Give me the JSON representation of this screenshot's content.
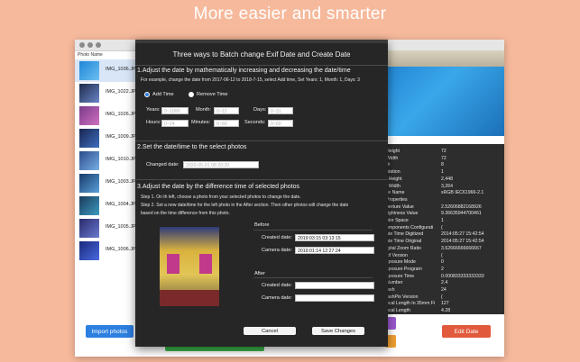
{
  "banner": {
    "title": "More easier and smarter"
  },
  "main_window": {
    "list_header": "Photo Name",
    "photos": [
      {
        "name": "IMG_1036.JPG",
        "selected": true
      },
      {
        "name": "IMG_1022.JPG",
        "selected": false
      },
      {
        "name": "IMG_1026.JPG",
        "selected": false
      },
      {
        "name": "IMG_1009.JPG",
        "selected": false
      },
      {
        "name": "IMG_1010.JPG",
        "selected": false
      },
      {
        "name": "IMG_1003.JPG",
        "selected": false
      },
      {
        "name": "IMG_1004.JPG",
        "selected": false
      },
      {
        "name": "IMG_1005.JPG",
        "selected": false
      },
      {
        "name": "IMG_1006.JPG",
        "selected": false
      }
    ],
    "import_button": "Import photos",
    "edit_button": "Edit Date",
    "colors": {
      "import": "#2d7fe0",
      "edit": "#e25a3c",
      "green": "#39b54a",
      "purple": "#9b59d0",
      "orange": "#f0a030"
    }
  },
  "exif_panel": {
    "rows": [
      {
        "k": "Height",
        "v": "72"
      },
      {
        "k": "Width",
        "v": "72"
      },
      {
        "k": "th",
        "v": "8"
      },
      {
        "k": "ntation",
        "v": "1"
      },
      {
        "k": "l Height",
        "v": "2,448"
      },
      {
        "k": "l Width",
        "v": "3,264"
      },
      {
        "k": "ile Name",
        "v": "sRGB IEC61966-2.1"
      },
      {
        "k": "Properties",
        "v": ""
      },
      {
        "k": "perture Value",
        "v": "2.52606882168926"
      },
      {
        "k": "rightness Value",
        "v": "9.36635944700461"
      },
      {
        "k": "olor Space",
        "v": "1"
      },
      {
        "k": "omponents Configurati",
        "v": "("
      },
      {
        "k": "ate Time Digitized",
        "v": "2014:05:27 15:42:54"
      },
      {
        "k": "ate Time Original",
        "v": "2014:05:27 15:42:54"
      },
      {
        "k": "igital Zoom Ratio",
        "v": "3.62666666666667"
      },
      {
        "k": "xif Version",
        "v": "("
      },
      {
        "k": "xposure Mode",
        "v": "0"
      },
      {
        "k": "xposure Program",
        "v": "2"
      },
      {
        "k": "xposure Time",
        "v": "0.000833333333333"
      },
      {
        "k": "Number",
        "v": "2.4"
      },
      {
        "k": "lash",
        "v": "24"
      },
      {
        "k": "lashPix Version",
        "v": "("
      },
      {
        "k": "ocal Length In 35mm Fi",
        "v": "127"
      },
      {
        "k": "ocal Length",
        "v": "4.28"
      }
    ]
  },
  "dialog": {
    "title": "Three ways to Batch change Exif Date and Create Date",
    "section1": {
      "heading": "1.Adjust the date by mathematically increasing and decreasing the date/time",
      "example": "For example, change the date from 2017-06-12 to 2018-7-15, select Add time, Set Years: 1, Month: 1, Days: 3",
      "add_time": "Add Time",
      "remove_time": "Remove Time",
      "years_label": "Years:",
      "years_ph": "0~1000",
      "month_label": "Month:",
      "month_ph": "0~12",
      "days_label": "Days:",
      "days_ph": "0~31",
      "hours_label": "Hours:",
      "hours_ph": "0~24",
      "minutes_label": "Minutes:",
      "minutes_ph": "0~60",
      "seconds_label": "Seconds:",
      "seconds_ph": "0~60"
    },
    "section2": {
      "heading": "2.Set the date/time to the select photos",
      "changed_label": "Changed date:",
      "changed_ph": "2020-05-01 08:20:30"
    },
    "section3": {
      "heading": "3.Adjust the date by the difference time of selected photos",
      "step1": "Step 1. On th left, choose a photo from your selected photos to change the date.",
      "step2": "Step 2. Set a new date/time for the left photo in the After section. Then other photos will change the date",
      "step2b": "based on the time difference from this photo.",
      "before": "Before",
      "created_label": "Created date:",
      "created_value": "2019:03:15 03:13:15",
      "camera_label": "Camera date:",
      "camera_value": "2019:01:14 12:27:24",
      "after": "After",
      "after_created_label": "Created date:",
      "after_camera_label": "Camera date:"
    },
    "cancel": "Cancel",
    "save": "Save Changes"
  }
}
